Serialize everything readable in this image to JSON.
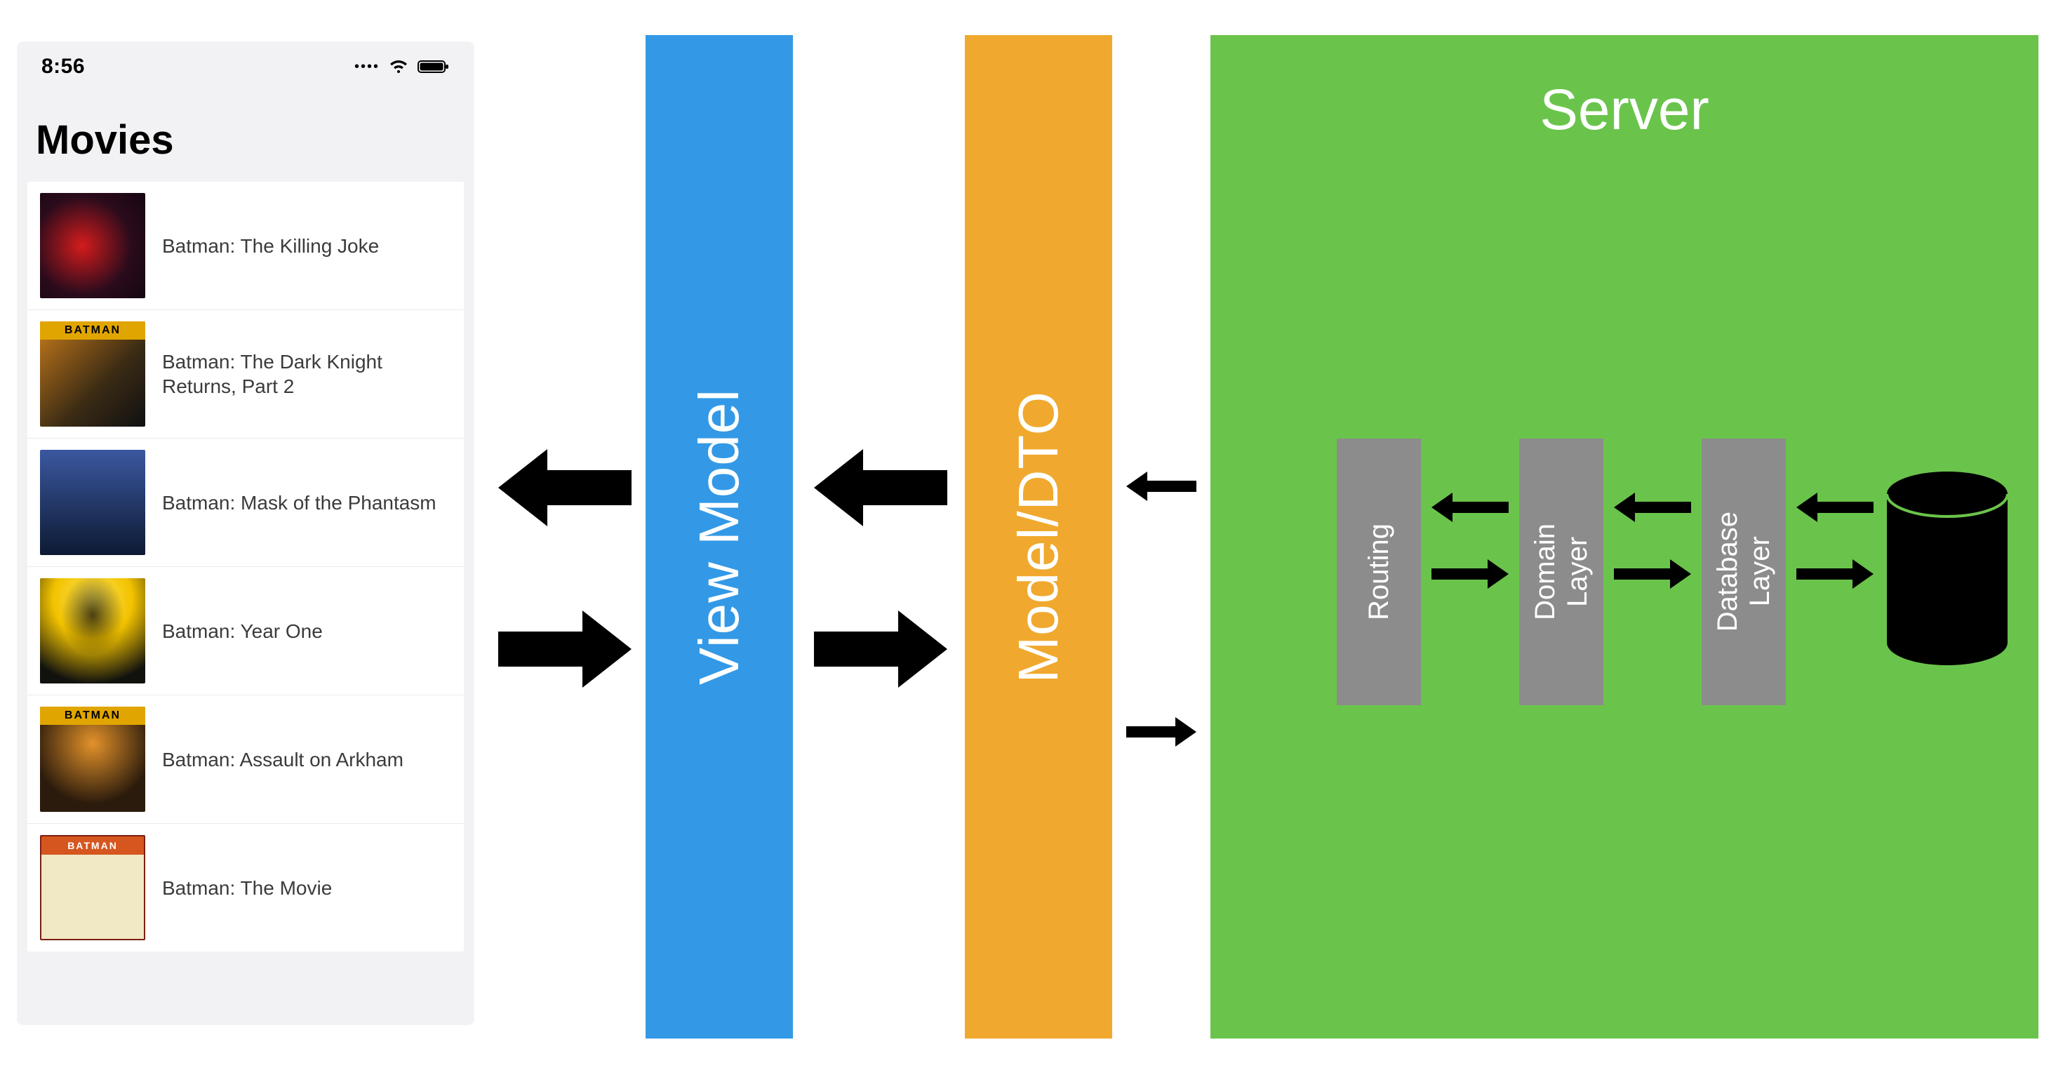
{
  "phone": {
    "time": "8:56",
    "title": "Movies",
    "movies": [
      {
        "title": "Batman: The Killing Joke"
      },
      {
        "title": "Batman: The Dark Knight Returns, Part 2"
      },
      {
        "title": "Batman: Mask of the Phantasm"
      },
      {
        "title": "Batman: Year One"
      },
      {
        "title": "Batman: Assault on Arkham"
      },
      {
        "title": "Batman: The Movie"
      }
    ]
  },
  "pillars": {
    "view_model": "View Model",
    "model_dto": "Model/DTO"
  },
  "server": {
    "title": "Server",
    "layers": {
      "routing": "Routing",
      "domain": "Domain\nLayer",
      "database": "Database\nLayer"
    }
  },
  "poster_badges": {
    "p2": "BATMAN",
    "p5": "BATMAN",
    "p6": "BATMAN"
  }
}
